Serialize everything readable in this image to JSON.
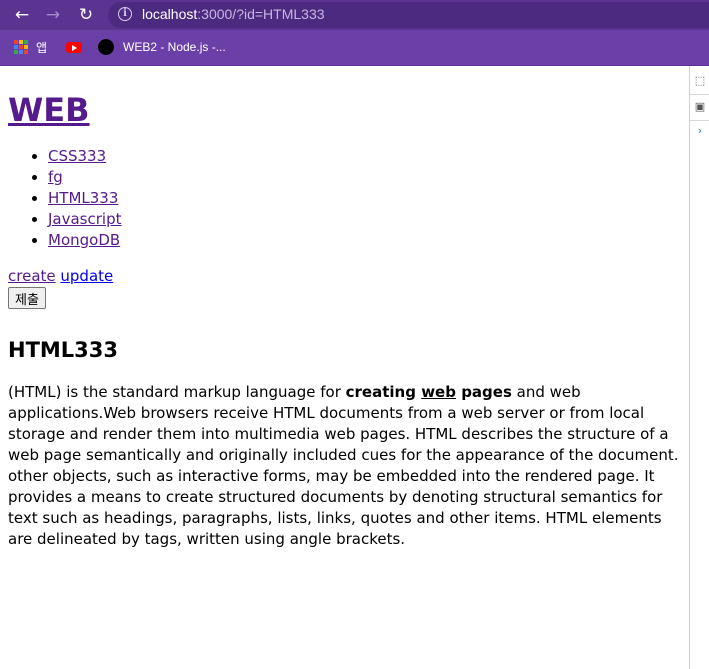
{
  "browser": {
    "url_host": "localhost",
    "url_rest": ":3000/?id=HTML333",
    "colors": {
      "toolbar": "#5b3391",
      "bookmarks_bar": "#6a40a8"
    },
    "icons": [
      "back-arrow-icon",
      "forward-arrow-icon",
      "reload-icon",
      "info-icon"
    ]
  },
  "bookmarks": [
    {
      "label": "앱",
      "icon": "apps-grid-icon"
    },
    {
      "label": "",
      "icon": "youtube-icon"
    },
    {
      "label": "WEB2 - Node.js -...",
      "icon": "web2-favicon-icon"
    }
  ],
  "page": {
    "title": "WEB",
    "topics": [
      "CSS333",
      "fg",
      "HTML333",
      "Javascript",
      "MongoDB"
    ],
    "actions": {
      "create": "create",
      "update": "update",
      "submit": "제출"
    },
    "doc_title": "HTML333",
    "body": {
      "intro": "(HTML) is the standard markup language for ",
      "bold_1": "creating ",
      "link": "web",
      "bold_2": " pages",
      "rest": " and web applications.Web browsers receive HTML documents from a web server or from local storage and render them into multimedia web pages. HTML describes the structure of a web page semantically and originally included cues for the appearance of the document. other objects, such as interactive forms, may be embedded into the rendered page. It provides a means to create structured documents by denoting structural semantics for text such as headings, paragraphs, lists, links, quotes and other items. HTML elements are delineated by tags, written using angle brackets."
    },
    "link_colors": {
      "visited": "#551a8b",
      "unvisited": "#0000ee"
    }
  }
}
